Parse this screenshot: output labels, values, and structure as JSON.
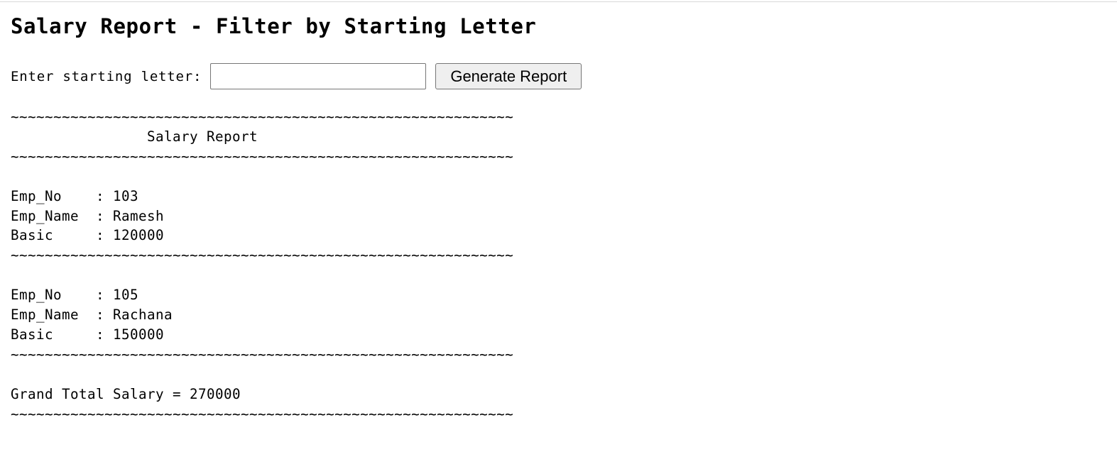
{
  "page": {
    "title": "Salary Report - Filter by Starting Letter"
  },
  "form": {
    "label": "Enter starting letter:",
    "input_value": "",
    "input_placeholder": "",
    "button_label": "Generate Report"
  },
  "report": {
    "separator": "~~~~~~~~~~~~~~~~~~~~~~~~~~~~~~~~~~~~~~~~~~~~~~~~~~~~~~~~~~~",
    "heading": "Salary Report",
    "employees": [
      {
        "emp_no": "103",
        "emp_name": "Ramesh",
        "basic": "120000"
      },
      {
        "emp_no": "105",
        "emp_name": "Rachana",
        "basic": "150000"
      }
    ],
    "field_labels": {
      "emp_no": "Emp_No",
      "emp_name": "Emp_Name",
      "basic": "Basic"
    },
    "grand_total_label": "Grand Total Salary",
    "grand_total_value": "270000"
  }
}
